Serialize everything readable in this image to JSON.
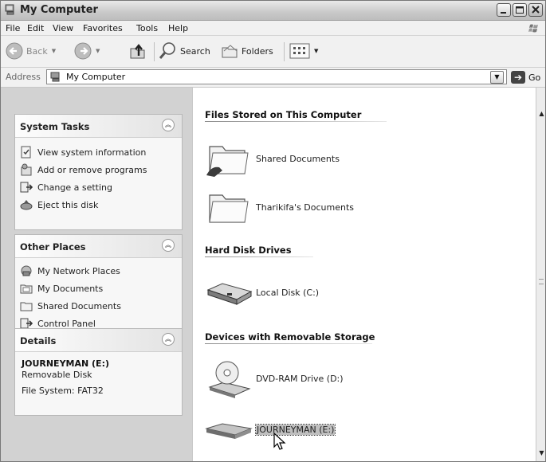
{
  "window": {
    "title": "My Computer"
  },
  "menu": {
    "items": [
      "File",
      "Edit",
      "View",
      "Favorites",
      "Tools",
      "Help"
    ]
  },
  "toolbar": {
    "back": "Back",
    "search": "Search",
    "folders": "Folders"
  },
  "address": {
    "label": "Address",
    "value": "My Computer",
    "go": "Go"
  },
  "left": {
    "system_tasks": {
      "title": "System Tasks",
      "items": [
        "View system information",
        "Add or remove programs",
        "Change a setting",
        "Eject this disk"
      ]
    },
    "other_places": {
      "title": "Other Places",
      "items": [
        "My Network Places",
        "My Documents",
        "Shared Documents",
        "Control Panel"
      ]
    },
    "details": {
      "title": "Details",
      "name": "JOURNEYMAN (E:)",
      "type": "Removable Disk",
      "filesystem": "File System: FAT32"
    }
  },
  "groups": {
    "files": {
      "title": "Files Stored on This Computer",
      "items": [
        "Shared Documents",
        "Tharikifa's Documents"
      ]
    },
    "hdd": {
      "title": "Hard Disk Drives",
      "items": [
        "Local Disk (C:)"
      ]
    },
    "removable": {
      "title": "Devices with Removable Storage",
      "items": [
        "DVD-RAM Drive (D:)",
        "JOURNEYMAN (E:)"
      ]
    }
  }
}
